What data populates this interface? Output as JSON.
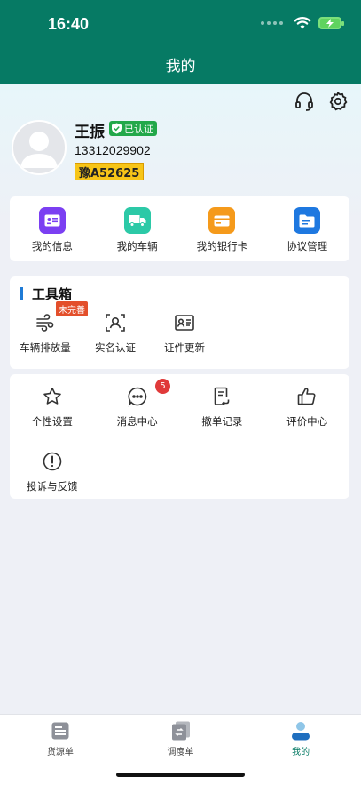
{
  "status_bar": {
    "time": "16:40"
  },
  "header": {
    "title": "我的"
  },
  "profile": {
    "name": "王振",
    "verified": "已认证",
    "phone": "13312029902",
    "plate": "豫A52625"
  },
  "quick_links": [
    {
      "label": "我的信息",
      "icon": "id-card-icon",
      "color": "#7b3ff2"
    },
    {
      "label": "我的车辆",
      "icon": "truck-icon",
      "color": "#2cc9a7"
    },
    {
      "label": "我的银行卡",
      "icon": "bank-card-icon",
      "color": "#f59a1b"
    },
    {
      "label": "协议管理",
      "icon": "folder-icon",
      "color": "#1e78e0"
    }
  ],
  "toolbox": {
    "title": "工具箱",
    "items": [
      {
        "label": "车辆排放量",
        "badge": "未完善",
        "icon": "wind-icon"
      },
      {
        "label": "实名认证",
        "icon": "face-scan-icon"
      },
      {
        "label": "证件更新",
        "icon": "certificate-icon"
      }
    ]
  },
  "more": {
    "items": [
      {
        "label": "个性设置",
        "icon": "star-icon"
      },
      {
        "label": "消息中心",
        "icon": "chat-icon",
        "badge": "5"
      },
      {
        "label": "撤单记录",
        "icon": "record-icon"
      },
      {
        "label": "评价中心",
        "icon": "thumbs-up-icon"
      },
      {
        "label": "投诉与反馈",
        "icon": "exclamation-icon"
      }
    ]
  },
  "tabbar": {
    "items": [
      {
        "label": "货源单",
        "active": false
      },
      {
        "label": "调度单",
        "active": false
      },
      {
        "label": "我的",
        "active": true
      }
    ]
  },
  "colors": {
    "primary": "#067a64",
    "accent": "#1f7bd6",
    "badge": "#e03a3a",
    "verified": "#23a84a",
    "plate": "#f7c518"
  }
}
